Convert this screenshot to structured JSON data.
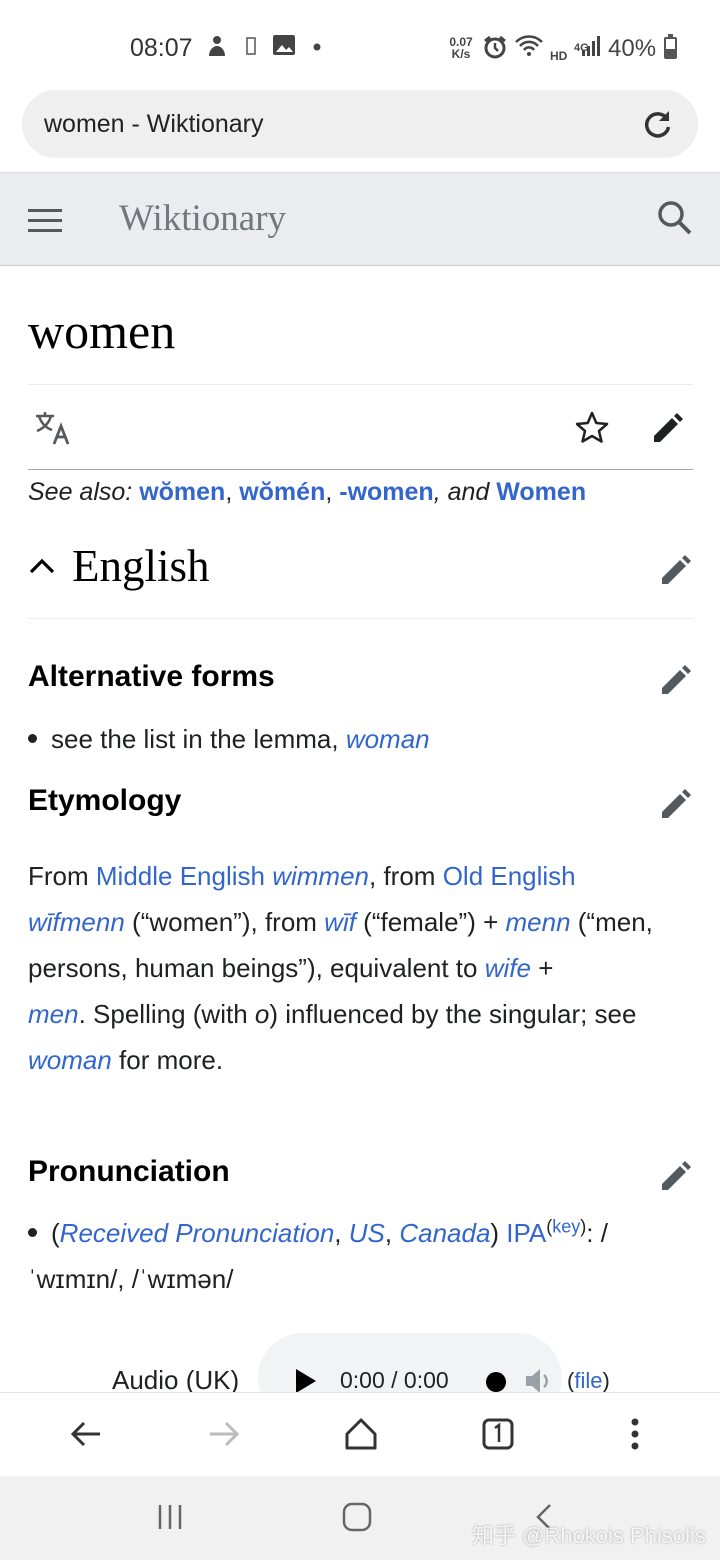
{
  "status_bar": {
    "time": "08:07",
    "net_speed_value": "0.07",
    "net_speed_unit": "K/s",
    "hd_label": "HD",
    "network_label": "4G",
    "battery": "40%"
  },
  "browser": {
    "url_title": "women - Wiktionary"
  },
  "header": {
    "site_name": "Wiktionary"
  },
  "page": {
    "title": "women",
    "see_also_label": "See also: ",
    "see_also_links": [
      "wŏmen",
      "wŏmén",
      "-women",
      "Women"
    ],
    "see_also_sep1": ", ",
    "see_also_sep2": ", ",
    "see_also_and": ", and ",
    "language": "English"
  },
  "alternative_forms": {
    "heading": "Alternative forms",
    "text": "see the list in the lemma, ",
    "link": "woman"
  },
  "etymology": {
    "heading": "Etymology",
    "p1": "From ",
    "l1": "Middle English",
    "s1": " ",
    "l2": "wimmen",
    "p2": ", from ",
    "l3": "Old English",
    "s2": " ",
    "l4": "wīfmenn",
    "p3": " (“women”), from ",
    "l5": "wīf",
    "p4": " (“female”) + ",
    "l6": "menn",
    "p5": " (“men, persons, human beings”), equivalent to ",
    "l7": "wife",
    "p6": " + ",
    "l8": "men",
    "p7": ". Spelling (with ",
    "p7i": "o",
    "p8": ") influenced by the singular; see ",
    "l9": "woman",
    "p9": " for more."
  },
  "pronunciation": {
    "heading": "Pronunciation",
    "open": "(",
    "l1": "Received Pronunciation",
    "c1": ", ",
    "l2": "US",
    "c2": ", ",
    "l3": "Canada",
    "close": ") ",
    "ipa": "IPA",
    "key_open": "(",
    "key": "key",
    "key_close": ")",
    "ipa_text": ": /ˈwɪmɪn/, /ˈwɪmən/",
    "audio_label": "Audio (UK)",
    "audio_time": "0:00 / 0:00",
    "file_open": "(",
    "file": "file",
    "file_close": ")"
  },
  "watermark": "知乎 @Rhokois Phisolis",
  "colors": {
    "link": "#3366cc",
    "header_bg": "#eaecf0",
    "text": "#202122"
  }
}
